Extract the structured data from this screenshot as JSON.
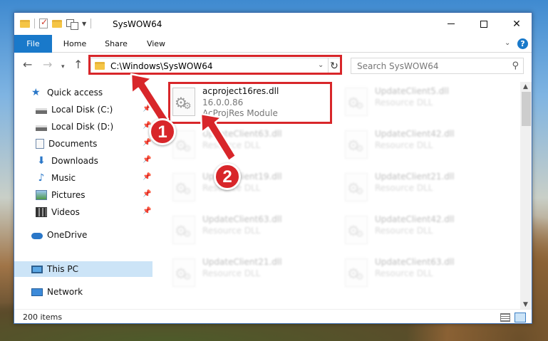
{
  "window": {
    "title": "SysWOW64",
    "minimize_symbol": "",
    "close_symbol": "✕"
  },
  "ribbon": {
    "tabs": [
      "File",
      "Home",
      "Share",
      "View"
    ],
    "help": "?"
  },
  "navigation": {
    "back": "←",
    "forward": "→",
    "recent": "▾",
    "up": "↑",
    "address": "C:\\Windows\\SysWOW64",
    "refresh": "↻",
    "search_placeholder": "Search SysWOW64"
  },
  "sidebar": {
    "items": [
      {
        "label": "Quick access",
        "icon": "star-icon"
      },
      {
        "label": "Local Disk (C:)",
        "icon": "disk-icon",
        "pinned": true
      },
      {
        "label": "Local Disk (D:)",
        "icon": "disk-icon",
        "pinned": true
      },
      {
        "label": "Documents",
        "icon": "documents-icon",
        "pinned": true
      },
      {
        "label": "Downloads",
        "icon": "downloads-icon",
        "pinned": true
      },
      {
        "label": "Music",
        "icon": "music-icon",
        "pinned": true
      },
      {
        "label": "Pictures",
        "icon": "pictures-icon",
        "pinned": true
      },
      {
        "label": "Videos",
        "icon": "videos-icon",
        "pinned": true
      },
      {
        "label": "OneDrive",
        "icon": "onedrive-icon"
      },
      {
        "label": "This PC",
        "icon": "pc-icon",
        "selected": true
      },
      {
        "label": "Network",
        "icon": "network-icon"
      }
    ]
  },
  "files": [
    {
      "name": "acproject16res.dll",
      "version": "16.0.0.86",
      "desc": "AcProjRes Module",
      "highlighted": true
    },
    {
      "name": "UpdateClient5.dll",
      "desc": "Resource DLL"
    },
    {
      "name": "UpdateClient63.dll",
      "desc": "Resource DLL"
    },
    {
      "name": "UpdateClient42.dll",
      "desc": "Resource DLL"
    },
    {
      "name": "UpdateClient19.dll",
      "desc": "Resource DLL"
    },
    {
      "name": "UpdateClient21.dll",
      "desc": "Resource DLL"
    },
    {
      "name": "UpdateClient63.dll",
      "desc": "Resource DLL"
    },
    {
      "name": "UpdateClient42.dll",
      "desc": "Resource DLL"
    },
    {
      "name": "UpdateClient21.dll",
      "desc": "Resource DLL"
    },
    {
      "name": "UpdateClient63.dll",
      "desc": "Resource DLL"
    }
  ],
  "status": {
    "item_count": "200 items"
  },
  "annotations": {
    "step1": "1",
    "step2": "2",
    "color": "#d8262a"
  }
}
